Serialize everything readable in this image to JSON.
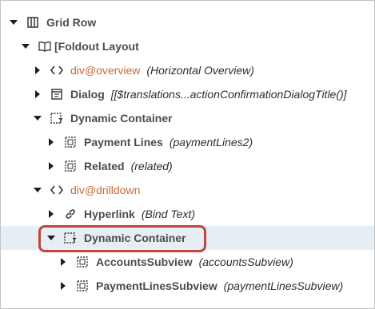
{
  "tree": {
    "rows": [
      {
        "label": "Grid Row",
        "note": "",
        "icon": "grid-icon"
      },
      {
        "label": "Foldout Layout",
        "prefix": "[",
        "note": "",
        "icon": "book-icon"
      },
      {
        "label": "div@overview",
        "note": "(Horizontal Overview)",
        "icon": "code-icon"
      },
      {
        "label": "Dialog",
        "note": "[[$translations...actionConfirmationDialogTitle()]",
        "icon": "dialog-icon"
      },
      {
        "label": "Dynamic Container",
        "note": "",
        "icon": "dynamic-container-icon"
      },
      {
        "label": "Payment Lines",
        "note": "(paymentLines2)",
        "icon": "container-icon"
      },
      {
        "label": "Related",
        "note": "(related)",
        "icon": "container-icon"
      },
      {
        "label": "div@drilldown",
        "note": "",
        "icon": "code-icon"
      },
      {
        "label": "Hyperlink",
        "note": "(Bind Text)",
        "icon": "link-icon"
      },
      {
        "label": "Dynamic Container",
        "note": "",
        "icon": "dynamic-container-icon"
      },
      {
        "label": "AccountsSubview",
        "note": "(accountsSubview)",
        "icon": "container-icon"
      },
      {
        "label": "PaymentLinesSubview",
        "note": "(paymentLinesSubview)",
        "icon": "container-icon"
      }
    ]
  },
  "colors": {
    "highlight": "#c0453a",
    "selected_row": "#e5eef5",
    "element_label_orange": "#c76b3a"
  }
}
